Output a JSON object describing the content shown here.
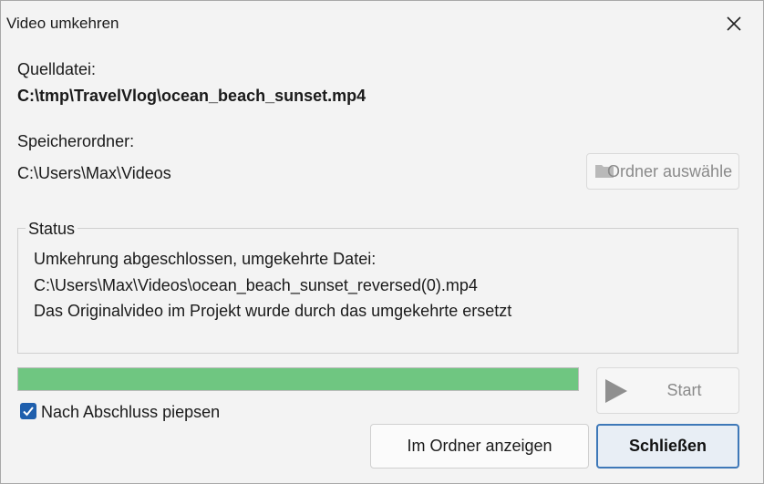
{
  "window": {
    "title": "Video umkehren"
  },
  "source": {
    "label": "Quelldatei:",
    "path": "C:\\tmp\\TravelVlog\\ocean_beach_sunset.mp4"
  },
  "output": {
    "label": "Speicherordner:",
    "path": "C:\\Users\\Max\\Videos",
    "choose_button": "Ordner auswähle"
  },
  "status": {
    "legend": "Status",
    "lines": [
      "Umkehrung abgeschlossen, umgekehrte Datei:",
      "C:\\Users\\Max\\Videos\\ocean_beach_sunset_reversed(0).mp4",
      "Das Originalvideo im Projekt wurde durch das umgekehrte ersetzt"
    ]
  },
  "progress": {
    "value": 1.0
  },
  "start_button": "Start",
  "beep": {
    "label": "Nach Abschluss piepsen",
    "checked": true
  },
  "buttons": {
    "show_in_folder": "Im Ordner anzeigen",
    "close": "Schließen"
  },
  "colors": {
    "progress_fill": "#6fc681",
    "checkbox_accent": "#1f5fad",
    "primary_border": "#3e78b8"
  }
}
